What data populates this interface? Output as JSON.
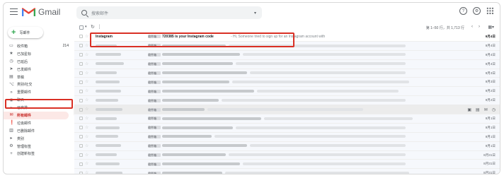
{
  "app": {
    "name": "Gmail"
  },
  "search": {
    "placeholder": "搜索邮件"
  },
  "compose_label": "写邮件",
  "colors": {
    "accent_red": "#d93025",
    "selected_bg": "#fce8e6",
    "gmail_red": "#ea4335"
  },
  "sidebar": {
    "items": [
      {
        "icon": "inbox-icon",
        "glyph": "▭",
        "label": "收件箱",
        "count": "214"
      },
      {
        "icon": "star-icon",
        "glyph": "★",
        "label": "已加星标",
        "count": ""
      },
      {
        "icon": "clock-icon",
        "glyph": "◷",
        "label": "已延后",
        "count": ""
      },
      {
        "icon": "send-icon",
        "glyph": "➤",
        "label": "已发邮件",
        "count": ""
      },
      {
        "icon": "draft-icon",
        "glyph": "▤",
        "label": "草稿",
        "count": ""
      },
      {
        "icon": "label-icon",
        "glyph": "⌥",
        "label": "类别/社交",
        "count": ""
      },
      {
        "icon": "important-icon",
        "glyph": "»",
        "label": "重要邮件",
        "count": ""
      },
      {
        "icon": "chat-icon",
        "glyph": "◉",
        "label": "聊天",
        "count": ""
      },
      {
        "icon": "scheduled-icon",
        "glyph": "➢",
        "label": "已安排",
        "count": ""
      },
      {
        "icon": "all-mail-icon",
        "glyph": "✉",
        "label": "所有邮件",
        "count": ""
      },
      {
        "icon": "spam-icon",
        "glyph": "❗",
        "label": "垃圾邮件",
        "count": ""
      },
      {
        "icon": "trash-icon",
        "glyph": "▥",
        "label": "已删除邮件",
        "count": ""
      },
      {
        "icon": "category-icon",
        "glyph": "▸",
        "label": "类别",
        "count": ""
      },
      {
        "icon": "manage-icon",
        "glyph": "⚙",
        "label": "管理标签",
        "count": ""
      },
      {
        "icon": "plus-icon",
        "glyph": "+",
        "label": "创建新标签",
        "count": ""
      }
    ]
  },
  "toolbar": {
    "range": "第 1–50 行，共 1,713 行"
  },
  "emails": [
    {
      "sender": "Instagram",
      "tag": "收件箱",
      "subject": "720385 is your Instagram code",
      "snippet": "- Hi, Someone tried to sign up for an Instagram account with",
      "date": "9月4日",
      "unread": true
    },
    {
      "sender": "",
      "tag": "收件箱",
      "subject": "",
      "snippet": "",
      "date": "9月4日",
      "unread": false
    },
    {
      "sender": "",
      "tag": "收件箱",
      "subject": "",
      "snippet": "",
      "date": "9月4日",
      "unread": false
    },
    {
      "sender": "",
      "tag": "收件箱",
      "subject": "",
      "snippet": "",
      "date": "9月4日",
      "unread": false
    },
    {
      "sender": "",
      "tag": "收件箱",
      "subject": "",
      "snippet": "",
      "date": "9月3日",
      "unread": false
    },
    {
      "sender": "",
      "tag": "收件箱",
      "subject": "",
      "snippet": "",
      "date": "9月3日",
      "unread": false
    },
    {
      "sender": "",
      "tag": "收件箱",
      "subject": "",
      "snippet": "",
      "date": "9月2日",
      "unread": false
    },
    {
      "sender": "",
      "tag": "收件箱",
      "subject": "",
      "snippet": "",
      "date": "9月2日",
      "unread": false
    },
    {
      "sender": "",
      "tag": "收件箱",
      "subject": "",
      "snippet": "",
      "date": "9月1日",
      "unread": false,
      "hovered": true
    },
    {
      "sender": "",
      "tag": "收件箱",
      "subject": "",
      "snippet": "",
      "date": "9月1日",
      "unread": false
    },
    {
      "sender": "",
      "tag": "收件箱",
      "subject": "",
      "snippet": "",
      "date": "9月1日",
      "unread": false
    },
    {
      "sender": "",
      "tag": "收件箱",
      "subject": "",
      "snippet": "",
      "date": "9月1日",
      "unread": false
    },
    {
      "sender": "",
      "tag": "收件箱",
      "subject": "",
      "snippet": "",
      "date": "9月1日",
      "unread": false
    },
    {
      "sender": "",
      "tag": "收件箱",
      "subject": "",
      "snippet": "",
      "date": "8月31日",
      "unread": false
    },
    {
      "sender": "",
      "tag": "收件箱",
      "subject": "",
      "snippet": "",
      "date": "8月31日",
      "unread": false
    },
    {
      "sender": "",
      "tag": "收件箱",
      "subject": "",
      "snippet": "",
      "date": "8月31日",
      "unread": false
    }
  ]
}
